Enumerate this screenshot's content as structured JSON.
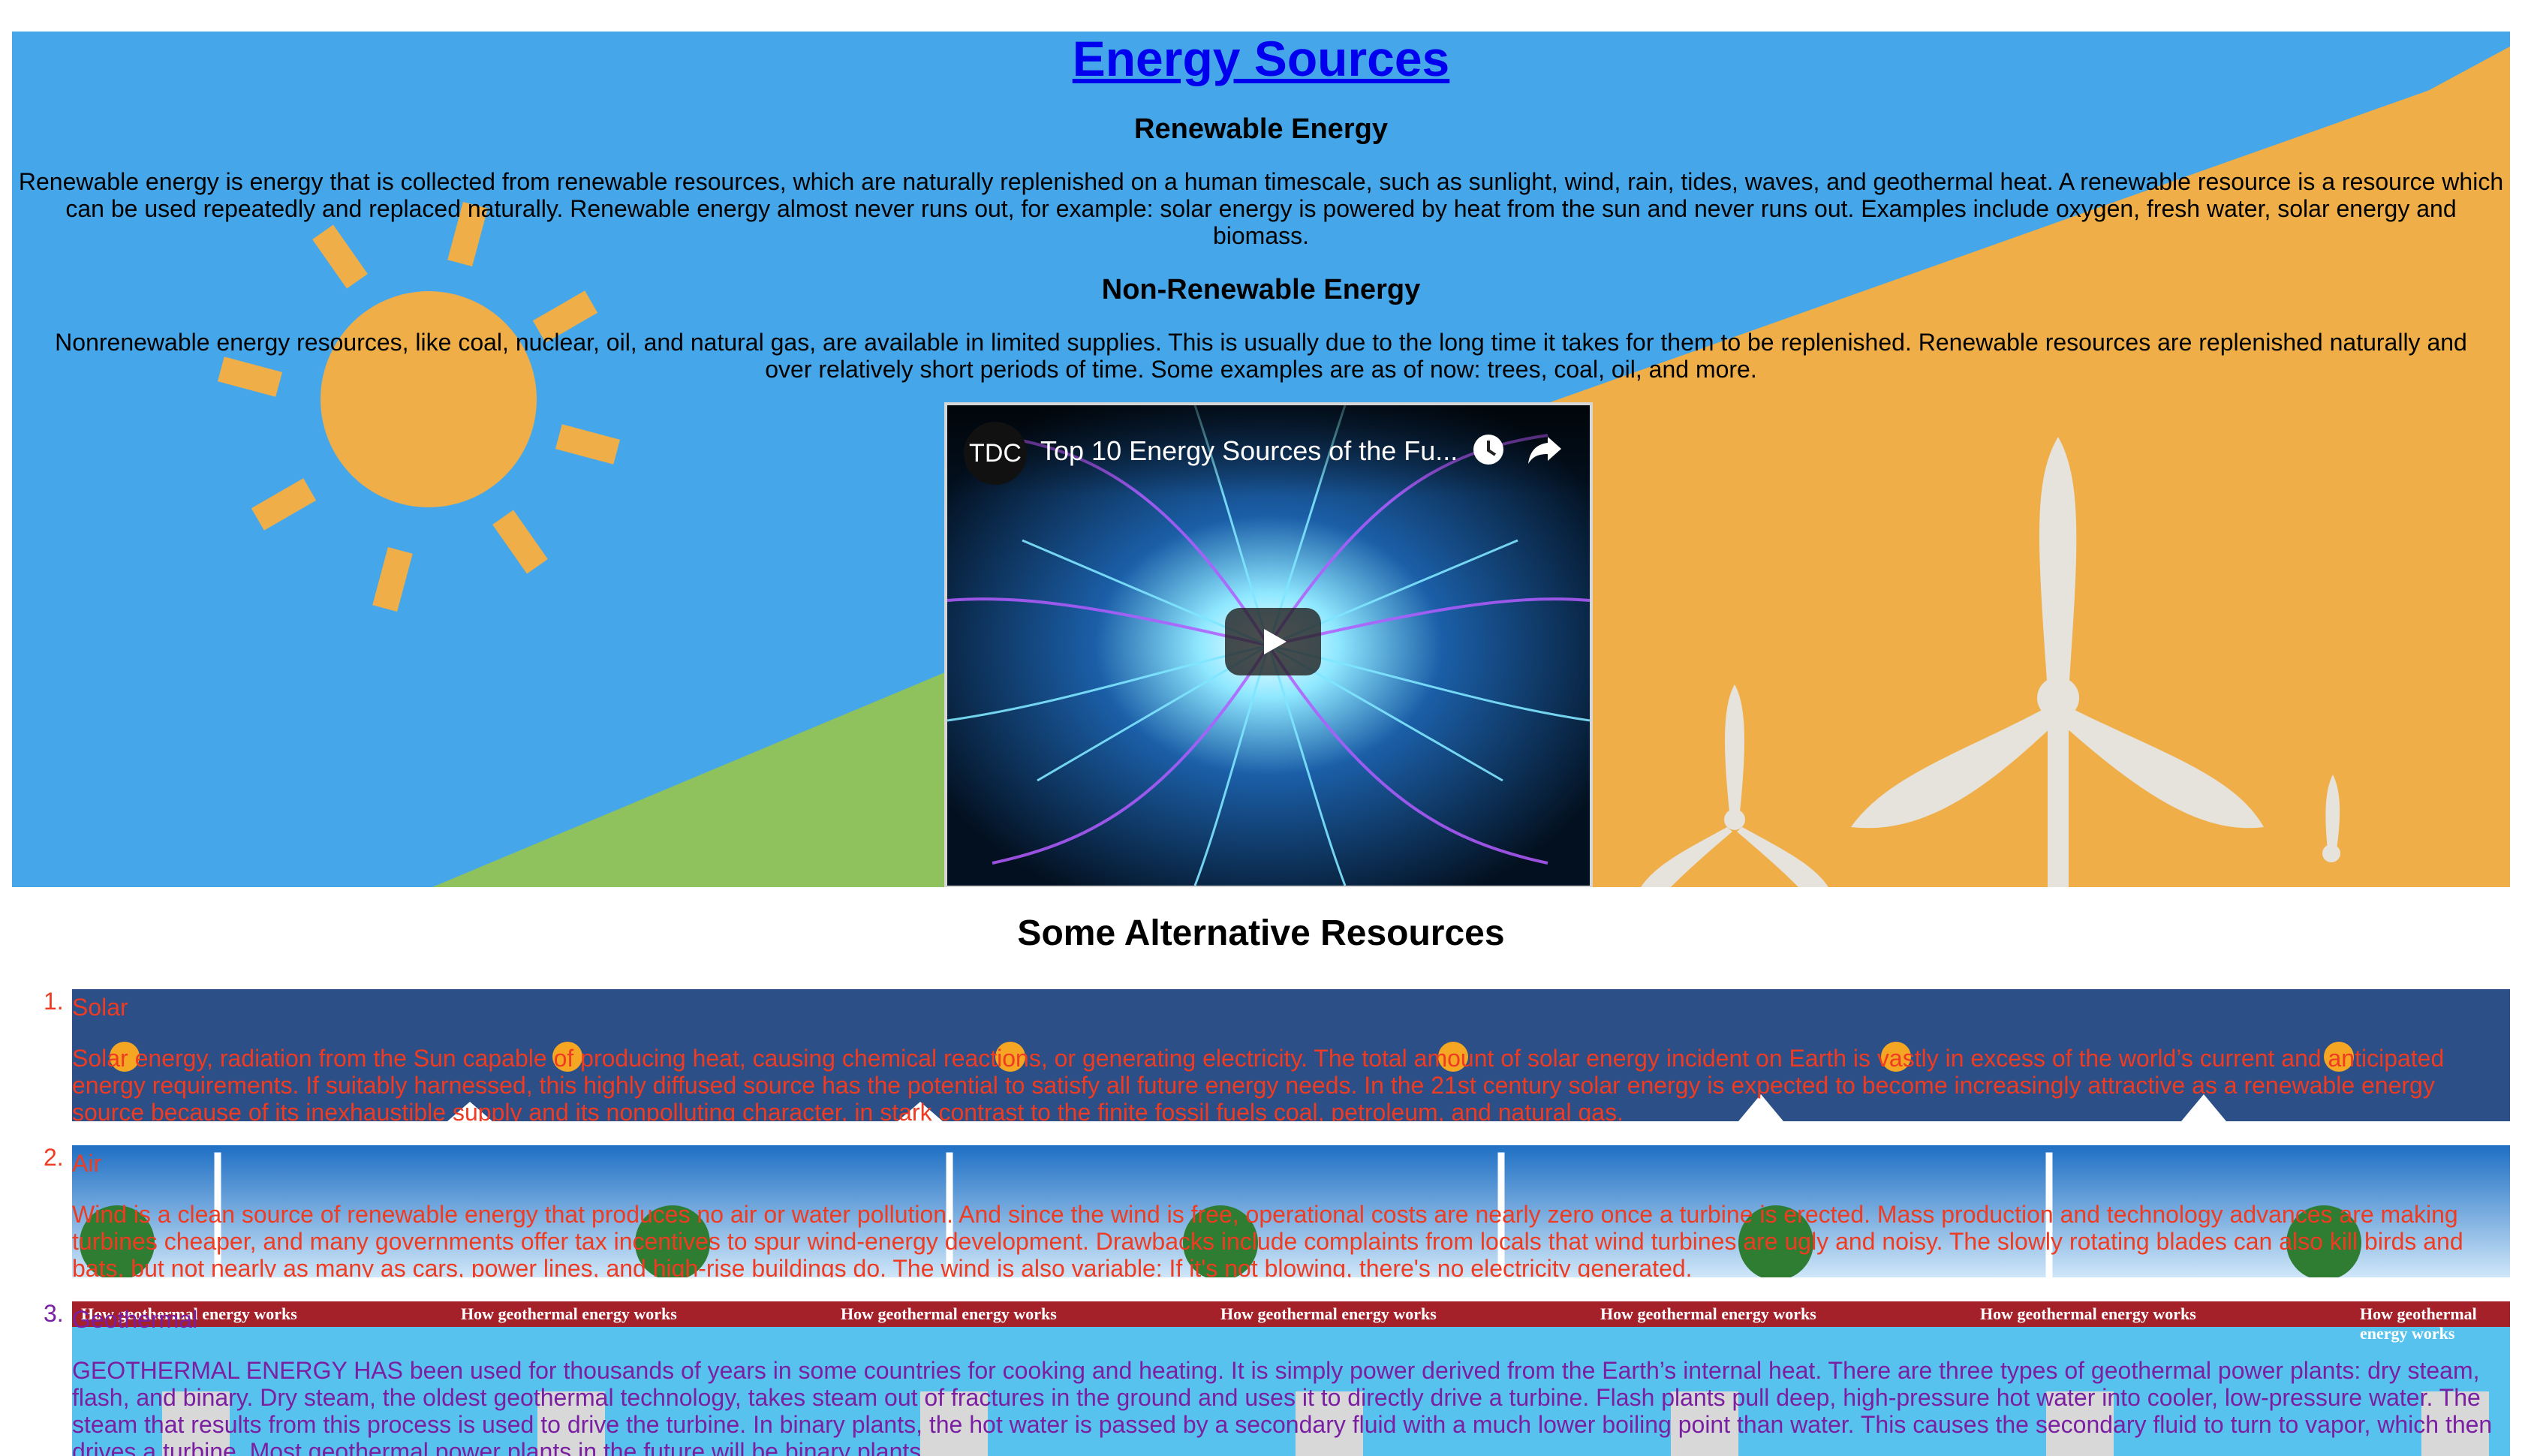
{
  "page": {
    "title": "Energy Sources"
  },
  "hero": {
    "renewable_heading": "Renewable Energy",
    "renewable_text": "Renewable energy is energy that is collected from renewable resources, which are naturally replenished on a human timescale, such as sunlight, wind, rain, tides, waves, and geothermal heat. A renewable resource is a resource which can be used repeatedly and replaced naturally. Renewable energy almost never runs out, for example: solar energy is powered by heat from the sun and never runs out. Examples include oxygen, fresh water, solar energy and biomass.",
    "nonrenewable_heading": "Non-Renewable Energy",
    "nonrenewable_text": "Nonrenewable energy resources, like coal, nuclear, oil, and natural gas, are available in limited supplies. This is usually due to the long time it takes for them to be replenished. Renewable resources are replenished naturally and over relatively short periods of time. Some examples are as of now: trees, coal, oil, and more.",
    "colors": {
      "sky": "#45a7ea",
      "field": "#efae48",
      "grass": "#8fc25d",
      "sun": "#efae48",
      "turbine": "#e6e2dc"
    }
  },
  "video": {
    "channel_logo": "TDC",
    "title": "Top 10 Energy Sources of the Fu...",
    "icons": [
      "clock-icon",
      "share-icon",
      "play-icon"
    ]
  },
  "alternatives": {
    "heading": "Some Alternative Resources",
    "items": [
      {
        "number": "1.",
        "name": "Solar",
        "description": "Solar energy, radiation from the Sun capable of producing heat, causing chemical reactions, or generating electricity. The total amount of solar energy incident on Earth is vastly in excess of the world’s current and anticipated energy requirements. If suitably harnessed, this highly diffused source has the potential to satisfy all future energy needs. In the 21st century solar energy is expected to become increasingly attractive as a renewable energy source because of its inexhaustible supply and its nonpolluting character, in stark contrast to the finite fossil fuels coal, petroleum, and natural gas.",
        "text_color": "#ef3b21"
      },
      {
        "number": "2.",
        "name": "Air",
        "description": "Wind is a clean source of renewable energy that produces no air or water pollution. And since the wind is free, operational costs are nearly zero once a turbine is erected. Mass production and technology advances are making turbines cheaper, and many governments offer tax incentives to spur wind-energy development. Drawbacks include complaints from locals that wind turbines are ugly and noisy. The slowly rotating blades can also kill birds and bats, but not nearly as many as cars, power lines, and high-rise buildings do. The wind is also variable: If it's not blowing, there's no electricity generated.",
        "text_color": "#ef3b21"
      },
      {
        "number": "3.",
        "name": "Geothermal",
        "banner_caption": "How geothermal energy works",
        "description": "GEOTHERMAL ENERGY HAS been used for thousands of years in some countries for cooking and heating. It is simply power derived from the Earth’s internal heat. There are three types of geothermal power plants: dry steam, flash, and binary. Dry steam, the oldest geothermal technology, takes steam out of fractures in the ground and uses it to directly drive a turbine. Flash plants pull deep, high-pressure hot water into cooler, low-pressure water. The steam that results from this process is used to drive the turbine. In binary plants, the hot water is passed by a secondary fluid with a much lower boiling point than water. This causes the secondary fluid to turn to vapor, which then drives a turbine. Most geothermal power plants in the future will be binary plants.",
        "text_color": "#7b1fa2"
      }
    ]
  }
}
